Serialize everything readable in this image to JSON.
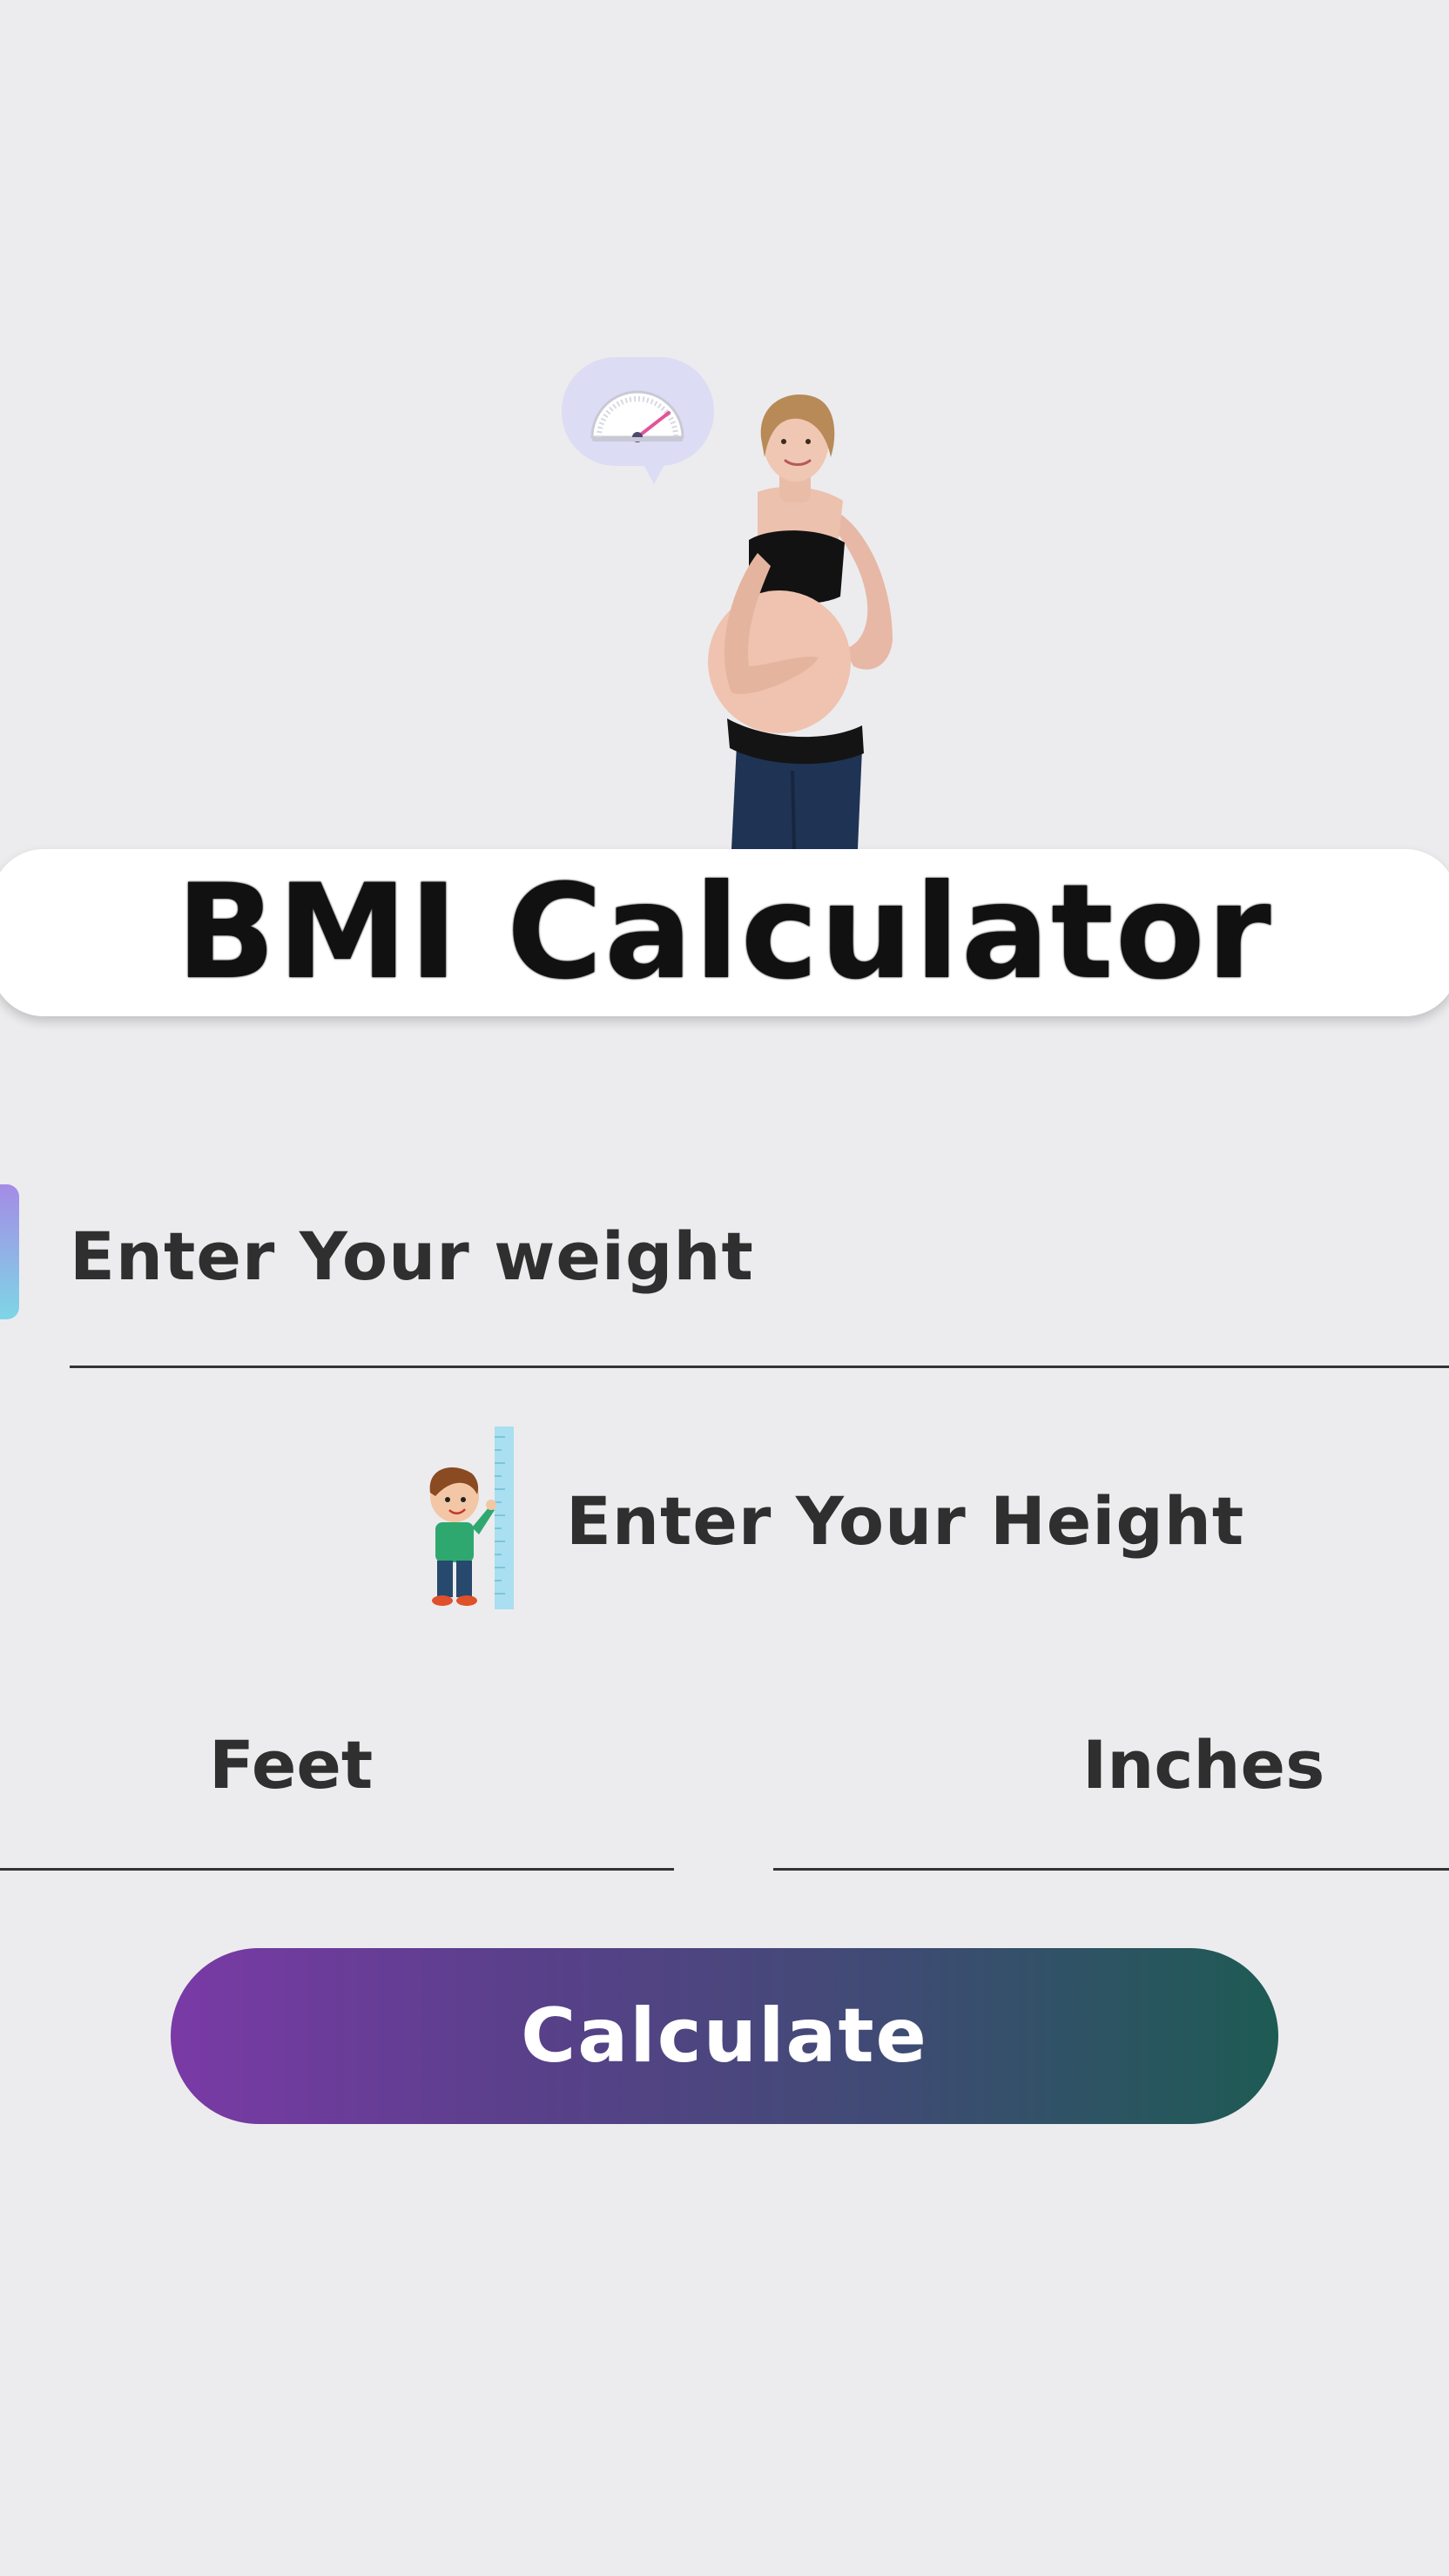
{
  "header": {
    "title": "BMI Calculator"
  },
  "hero": {
    "bubble_icon": "weight-gauge-icon",
    "figure": "pregnant-woman-illustration"
  },
  "weight": {
    "placeholder": "Enter Your weight",
    "value": ""
  },
  "height": {
    "label": "Enter Your Height",
    "icon": "kid-height-ruler-icon",
    "feet": {
      "placeholder": "Feet",
      "value": ""
    },
    "inches": {
      "placeholder": "Inches",
      "value": ""
    }
  },
  "actions": {
    "calculate_label": "Calculate"
  },
  "colors": {
    "background": "#ececee",
    "gradient_start": "#7a3aa6",
    "gradient_end": "#1e5b54",
    "accent_top": "#a58be6",
    "accent_bottom": "#7ed6e6"
  }
}
